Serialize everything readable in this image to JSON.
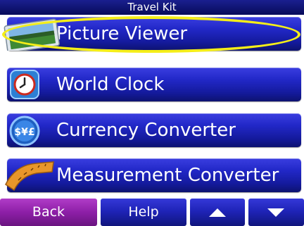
{
  "header": {
    "title": "Travel Kit"
  },
  "menu": {
    "items": [
      {
        "label": "Picture Viewer",
        "icon": "picture-icon"
      },
      {
        "label": "World Clock",
        "icon": "clock-icon"
      },
      {
        "label": "Currency Converter",
        "icon": "currency-icon"
      },
      {
        "label": "Measurement Converter",
        "icon": "ruler-icon"
      }
    ]
  },
  "toolbar": {
    "back_label": "Back",
    "help_label": "Help",
    "up_icon": "arrow-up-icon",
    "down_icon": "arrow-down-icon"
  },
  "colors": {
    "title_bar": "#0b0f6e",
    "button_blue": "#1f24b8",
    "back_purple": "#8d1fa7",
    "highlight": "#f5ee18"
  }
}
